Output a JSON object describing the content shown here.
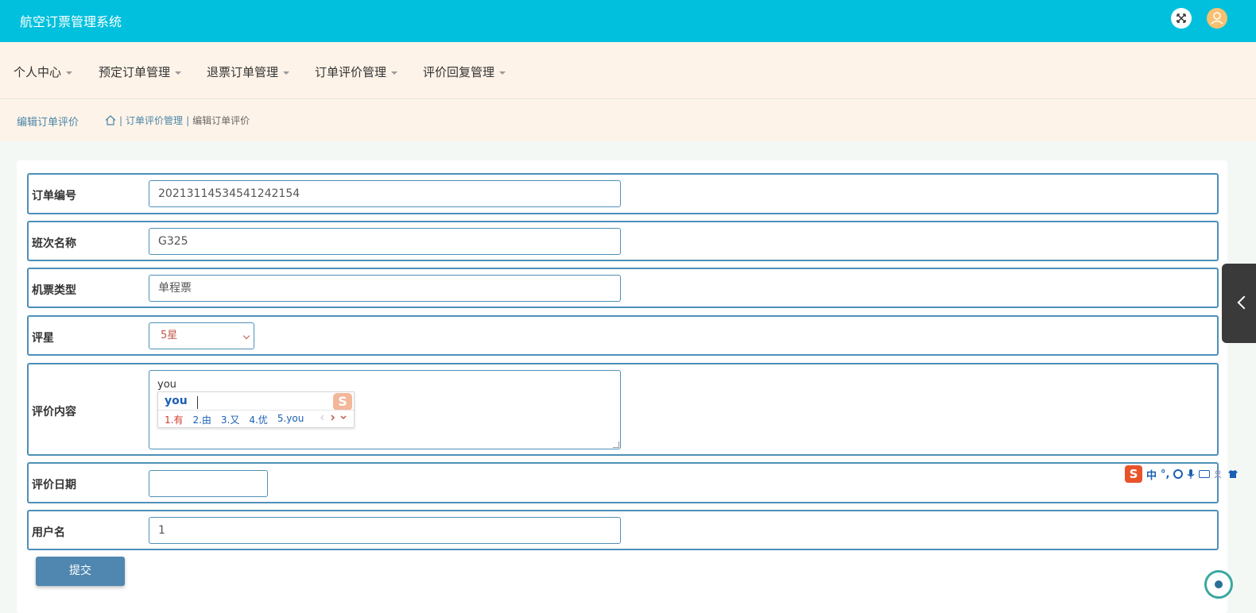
{
  "app": {
    "title": "航空订票管理系统"
  },
  "nav": {
    "items": [
      {
        "label": "个人中心"
      },
      {
        "label": "预定订单管理"
      },
      {
        "label": "退票订单管理"
      },
      {
        "label": "订单评价管理"
      },
      {
        "label": "评价回复管理"
      }
    ]
  },
  "breadcrumb": {
    "page_title": "编辑订单评价",
    "path": [
      "订单评价管理",
      "编辑订单评价"
    ],
    "separator": "|"
  },
  "form": {
    "order_no": {
      "label": "订单编号",
      "value": "20213114534541242154"
    },
    "flight_name": {
      "label": "班次名称",
      "value": "G325"
    },
    "ticket_type": {
      "label": "机票类型",
      "value": "单程票"
    },
    "rating": {
      "label": "评星",
      "value": "5星"
    },
    "content": {
      "label": "评价内容",
      "value": "you"
    },
    "review_date": {
      "label": "评价日期",
      "value": ""
    },
    "username": {
      "label": "用户名",
      "value": "1"
    },
    "submit_label": "提交"
  },
  "ime": {
    "composition": "you",
    "candidates": [
      "1.有",
      "2.由",
      "3.又",
      "4.优",
      "5.you"
    ],
    "logo": "S",
    "toolbar": {
      "logo": "S",
      "mode": "中",
      "punct": "°,"
    }
  },
  "colors": {
    "topbar": "#00c0dd",
    "navbar": "#fef3e8",
    "accent": "#4f87b0",
    "border": "#4d90b8"
  }
}
